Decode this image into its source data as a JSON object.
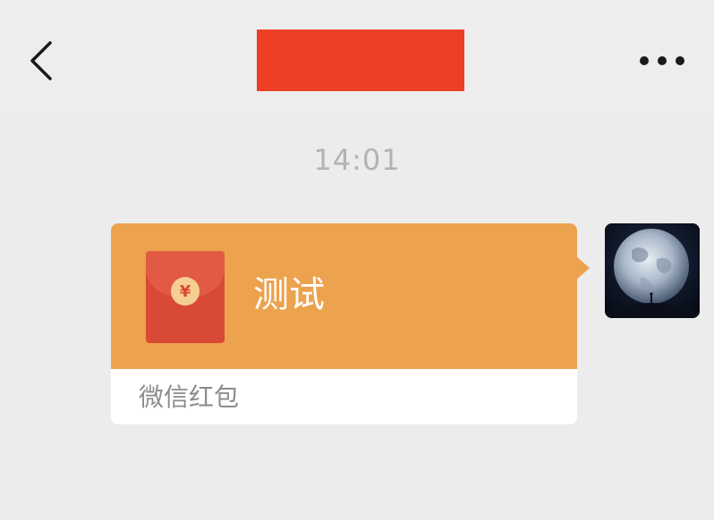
{
  "header": {
    "back_icon": "chevron-left-icon",
    "title_redacted_color": "#ec3f25",
    "more_icon": "ellipsis-icon"
  },
  "chat": {
    "timestamp": "14:01",
    "messages": [
      {
        "type": "red-packet",
        "sender": "self",
        "title": "测试",
        "footer_label": "微信红包",
        "coin_symbol": "¥",
        "bubble_color": "#eda24e",
        "envelope_color": "#d84a35"
      }
    ]
  },
  "avatar": {
    "icon": "avatar-earth-image"
  }
}
